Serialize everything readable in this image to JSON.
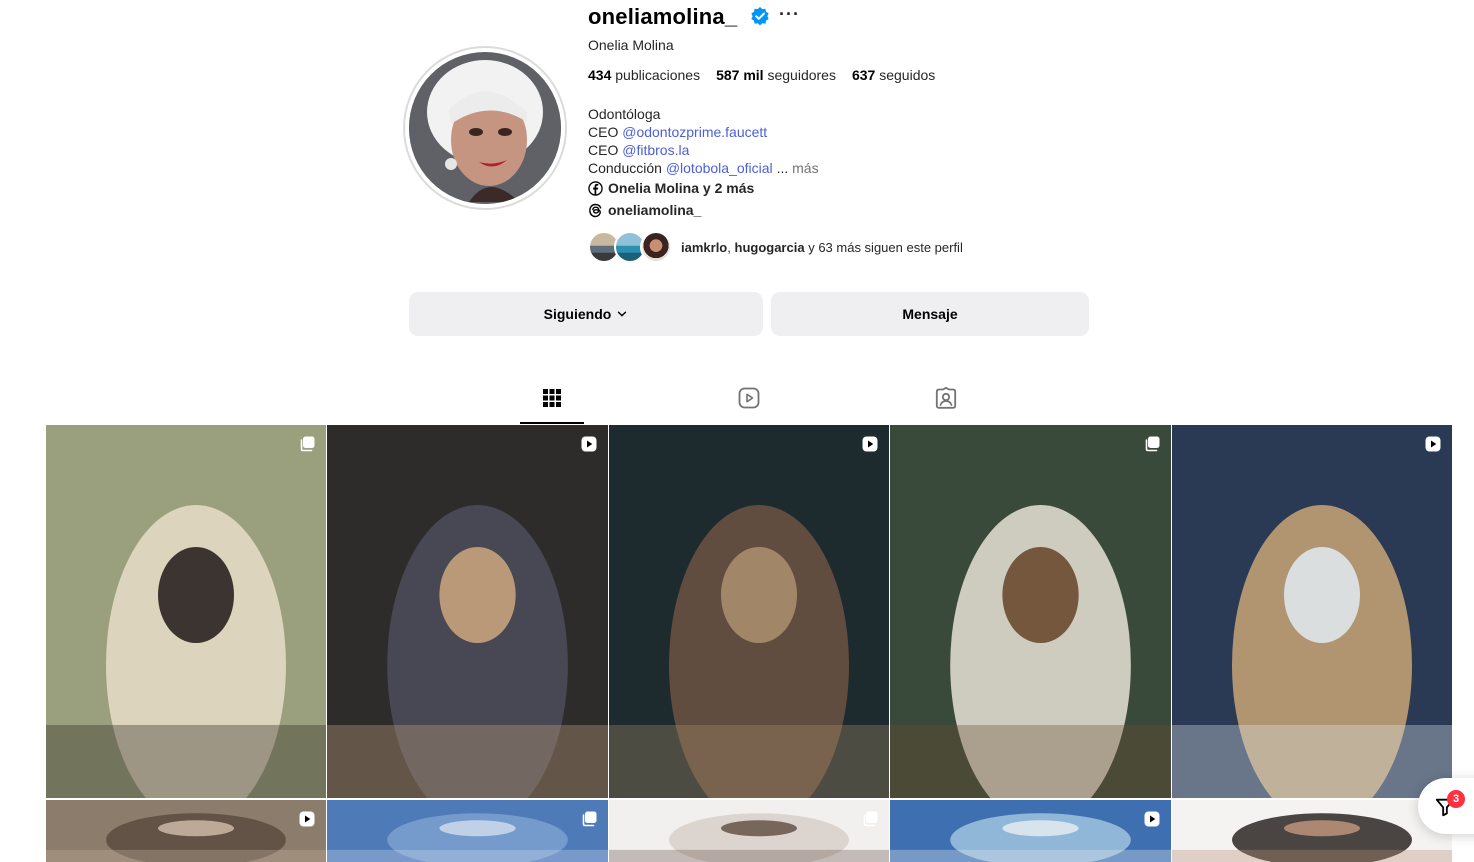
{
  "profile": {
    "username": "oneliamolina_",
    "full_name": "Onelia Molina",
    "more_label": "···",
    "stats": {
      "posts_value": "434",
      "posts_label": "publicaciones",
      "followers_value": "587 mil",
      "followers_label": "seguidores",
      "following_value": "637",
      "following_label": "seguidos"
    },
    "bio": {
      "line1": "Odontóloga",
      "line2_prefix": "CEO",
      "line2_mention": "@odontozprime.faucett",
      "line3_prefix": "CEO",
      "line3_mention": "@fitbros.la",
      "line4_prefix": "Conducción",
      "line4_mention": "@lotobola_oficial",
      "ellipsis": "...",
      "more": "más"
    },
    "facebook_link": "Onelia Molina y 2 más",
    "threads_link": "oneliamolina_",
    "followed_by": {
      "user1": "iamkrlo",
      "sep": ",",
      "user2": "hugogarcia",
      "rest": "y 63 más siguen este perfil"
    }
  },
  "actions": {
    "following_label": "Siguiendo",
    "message_label": "Mensaje"
  },
  "tabs": [
    {
      "name": "posts",
      "icon": "grid-icon",
      "active": true
    },
    {
      "name": "reels",
      "icon": "reels-icon",
      "active": false
    },
    {
      "name": "tagged",
      "icon": "tagged-icon",
      "active": false
    }
  ],
  "posts": [
    {
      "type": "carousel"
    },
    {
      "type": "reel"
    },
    {
      "type": "reel"
    },
    {
      "type": "carousel"
    },
    {
      "type": "reel"
    },
    {
      "type": "reel"
    },
    {
      "type": "carousel"
    },
    {
      "type": "carousel"
    },
    {
      "type": "reel"
    },
    {
      "type": "image"
    }
  ],
  "notifications": {
    "count": "3",
    "icon": "filter-icon"
  },
  "colors": {
    "mention": "#4c5fd5",
    "verified": "#0095f6",
    "button_bg": "#efeff1",
    "badge": "#ff3040"
  }
}
